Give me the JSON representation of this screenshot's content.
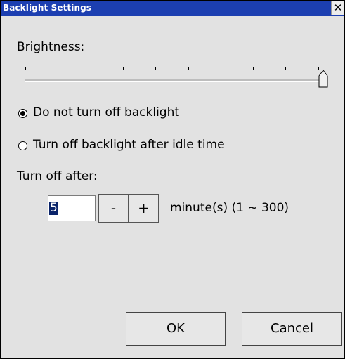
{
  "window": {
    "title": "Backlight Settings",
    "close_glyph": "✕"
  },
  "brightness": {
    "label": "Brightness:",
    "ticks": 10,
    "value_fraction": 1.0
  },
  "options": [
    {
      "label": "Do not turn off backlight",
      "checked": true
    },
    {
      "label": "Turn off backlight after idle time",
      "checked": false
    }
  ],
  "turn_off": {
    "label": "Turn off after:",
    "value": "5",
    "decrement_label": "-",
    "increment_label": "+",
    "unit_text": "minute(s) (1 ~ 300)"
  },
  "buttons": {
    "ok": "OK",
    "cancel": "Cancel"
  },
  "colors": {
    "titlebar": "#1c3fb1",
    "selection": "#0a246a",
    "dialog_bg": "#e2e2e2"
  }
}
